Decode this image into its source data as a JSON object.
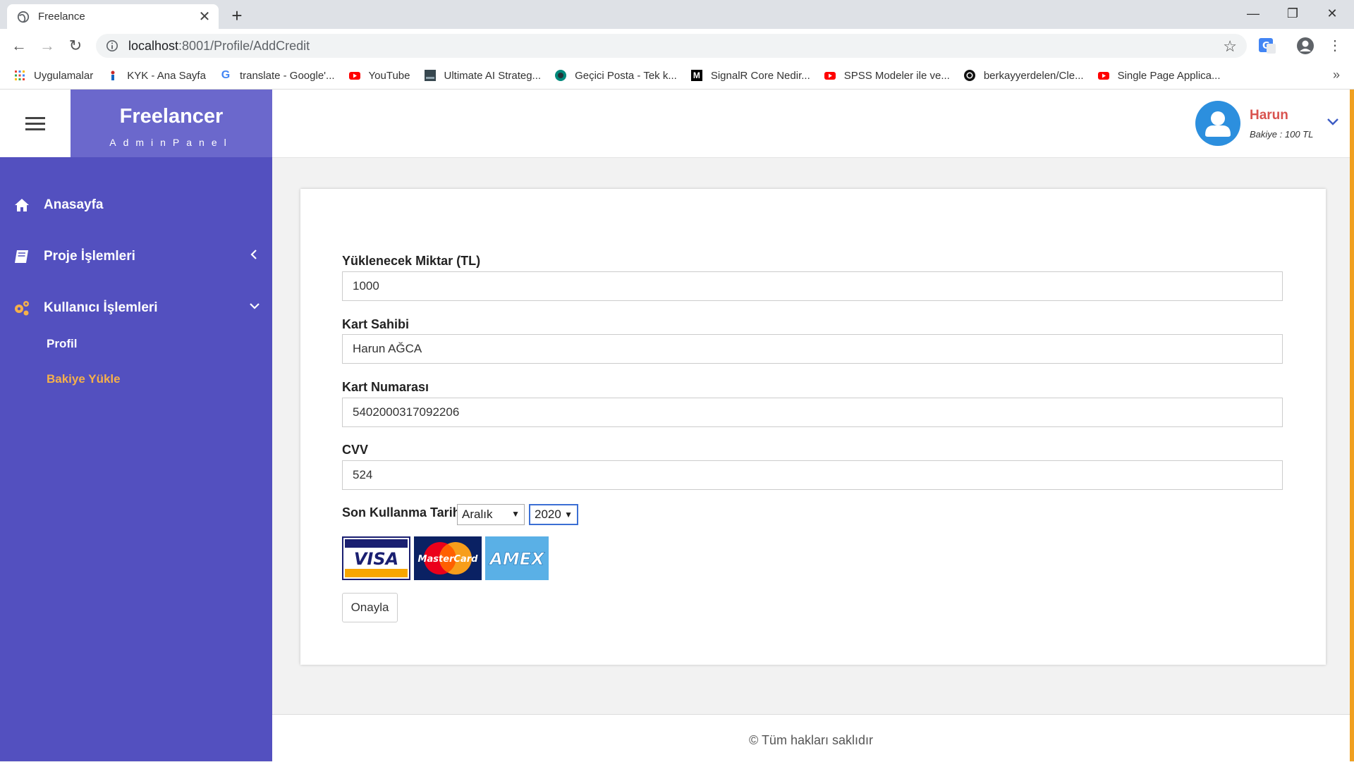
{
  "browser": {
    "tab_title": "Freelance",
    "url_host": "localhost",
    "url_path": ":8001/Profile/AddCredit",
    "bookmarks": [
      {
        "label": "Uygulamalar",
        "icon": "apps-grid-icon"
      },
      {
        "label": "KYK - Ana Sayfa",
        "icon": "kyk-icon"
      },
      {
        "label": "translate - Google'...",
        "icon": "google-icon"
      },
      {
        "label": "YouTube",
        "icon": "youtube-icon"
      },
      {
        "label": "Ultimate AI Strateg...",
        "icon": "site-icon"
      },
      {
        "label": "Geçici Posta - Tek k...",
        "icon": "mail-icon"
      },
      {
        "label": "SignalR Core Nedir...",
        "icon": "medium-icon"
      },
      {
        "label": "SPSS Modeler ile ve...",
        "icon": "youtube-icon"
      },
      {
        "label": "berkayyerdelen/Cle...",
        "icon": "github-icon"
      },
      {
        "label": "Single Page Applica...",
        "icon": "youtube-icon"
      }
    ]
  },
  "brand": {
    "name": "Freelancer",
    "sub": "AdminPanel"
  },
  "sidebar": {
    "items": [
      {
        "label": "Anasayfa"
      },
      {
        "label": "Proje İşlemleri"
      },
      {
        "label": "Kullanıcı İşlemleri"
      }
    ],
    "sub_items": [
      {
        "label": "Profil",
        "color": "#ffffff"
      },
      {
        "label": "Bakiye Yükle",
        "color": "#f5b04a"
      }
    ],
    "bg_color": "#5350bf"
  },
  "user": {
    "name": "Harun",
    "balance": "Bakiye : 100 TL"
  },
  "form": {
    "amount_label": "Yüklenecek Miktar (TL)",
    "amount_value": "1000",
    "holder_label": "Kart Sahibi",
    "holder_value": "Harun AĞCA",
    "number_label": "Kart Numarası",
    "number_value": "5402000317092206",
    "cvv_label": "CVV",
    "cvv_value": "524",
    "expiry_label": "Son Kullanma Tarihi",
    "expiry_month": "Aralık",
    "expiry_year": "2020",
    "submit_label": "Onayla"
  },
  "cards": {
    "visa": "VISA",
    "mastercard": "MasterCard",
    "amex": "AMEX"
  },
  "footer": {
    "copyright": "© Tüm hakları saklıdır"
  }
}
